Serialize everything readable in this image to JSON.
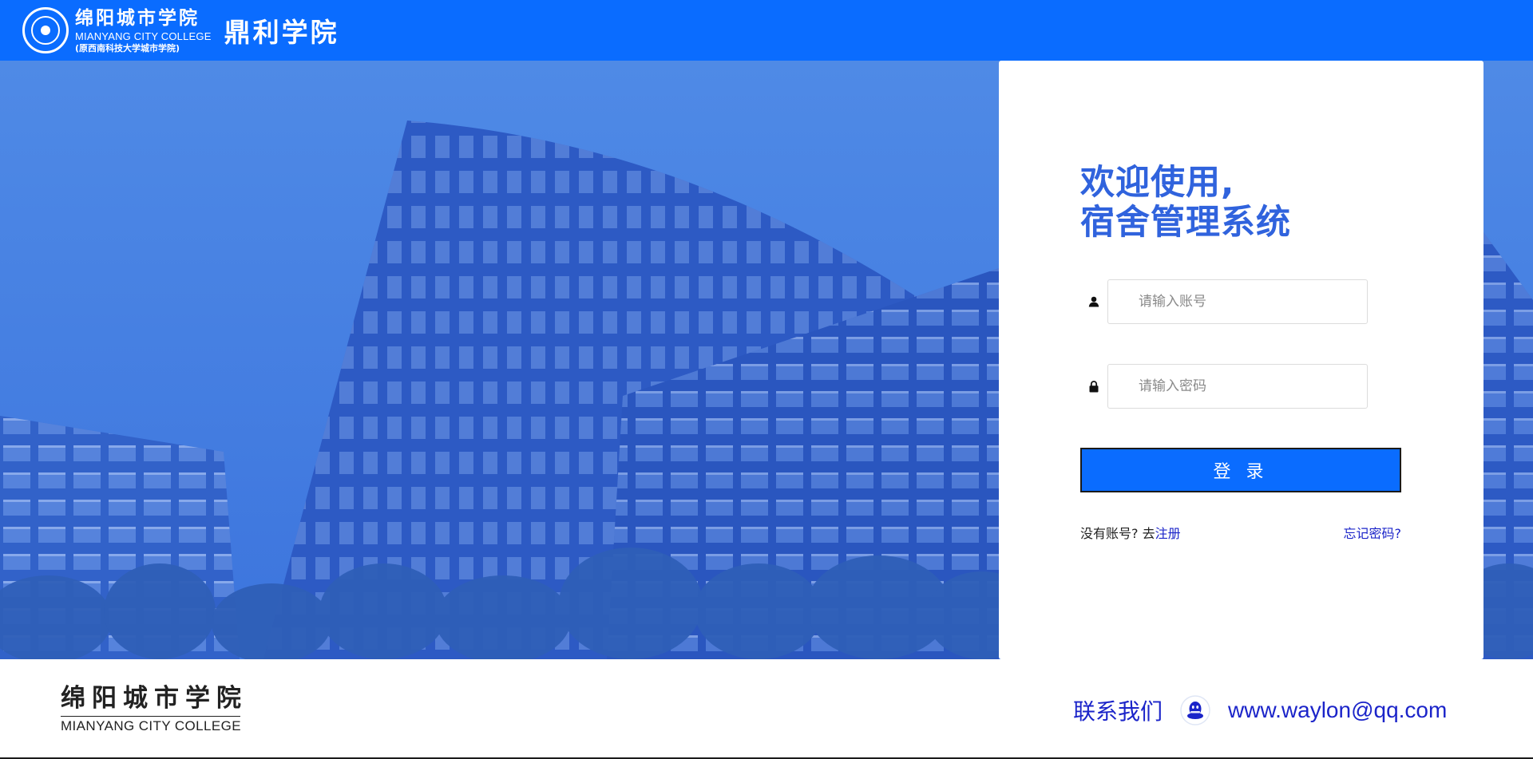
{
  "header": {
    "logo": {
      "name_cn": "绵阳城市学院",
      "name_en": "MIANYANG CITY COLLEGE",
      "former_name": "(原西南科技大学城市学院)"
    },
    "department": "鼎利学院"
  },
  "login": {
    "welcome_line1": "欢迎使用,",
    "welcome_line2": "宿舍管理系统",
    "username_placeholder": "请输入账号",
    "password_placeholder": "请输入密码",
    "username_icon": "user-icon",
    "password_icon": "lock-icon",
    "submit_label": "登 录",
    "no_account_text": "没有账号? 去",
    "register_label": "注册",
    "forgot_label": "忘记密码?"
  },
  "footer": {
    "logo_cn": "绵阳城市学院",
    "logo_en": "MIANYANG CITY COLLEGE",
    "contact_label": "联系我们",
    "contact_icon": "qq-icon",
    "contact_email": "www.waylon@qq.com"
  },
  "colors": {
    "primary": "#0a6cff",
    "hero_overlay": "#3a72e0",
    "welcome_text": "#3063dd",
    "link": "#1b24c9"
  }
}
